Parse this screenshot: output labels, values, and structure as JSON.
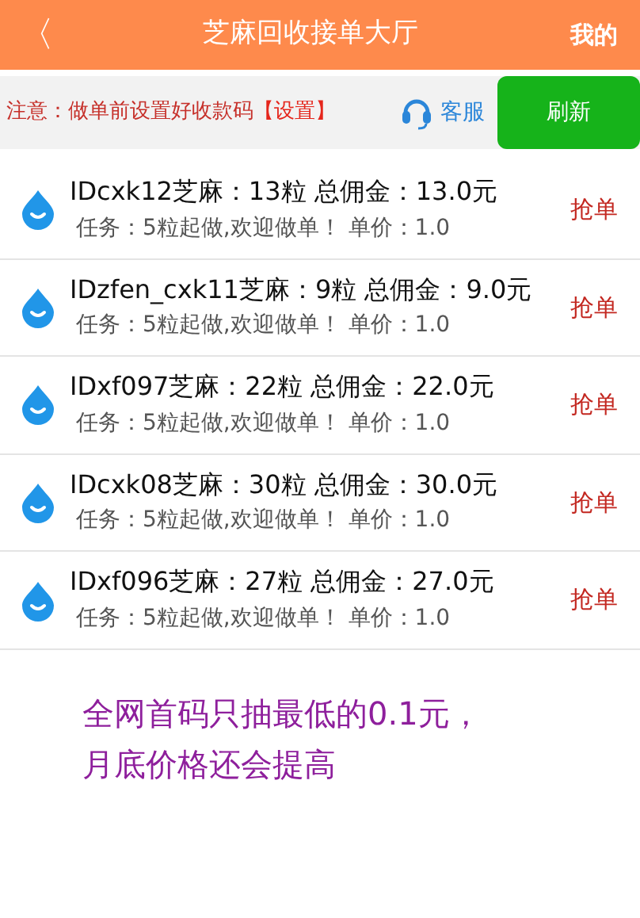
{
  "header": {
    "back": "〈",
    "title": "芝麻回收接单大厅",
    "mine": "我的"
  },
  "notice": {
    "text": "注意：做单前设置好收款码",
    "link": "【设置】",
    "service": "客服",
    "refresh": "刷新"
  },
  "orders": [
    {
      "title": "IDcxk12芝麻：13粒 总佣金：13.0元",
      "task": "任务：5粒起做,欢迎做单！ 单价：1.0",
      "action": "抢单"
    },
    {
      "title": "IDzfen_cxk11芝麻：9粒 总佣金：9.0元",
      "task": "任务：5粒起做,欢迎做单！ 单价：1.0",
      "action": "抢单"
    },
    {
      "title": "IDxf097芝麻：22粒 总佣金：22.0元",
      "task": "任务：5粒起做,欢迎做单！ 单价：1.0",
      "action": "抢单"
    },
    {
      "title": "IDcxk08芝麻：30粒 总佣金：30.0元",
      "task": "任务：5粒起做,欢迎做单！ 单价：1.0",
      "action": "抢单"
    },
    {
      "title": "IDxf096芝麻：27粒 总佣金：27.0元",
      "task": "任务：5粒起做,欢迎做单！ 单价：1.0",
      "action": "抢单"
    }
  ],
  "promo": [
    "全网首码只抽最低的0.1元，",
    "月底价格还会提高"
  ]
}
